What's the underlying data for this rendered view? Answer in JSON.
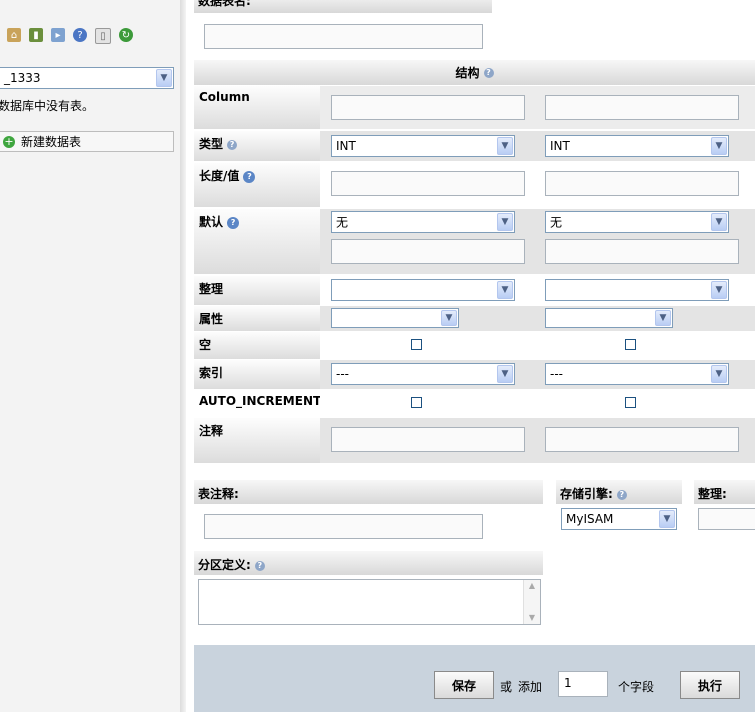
{
  "sidebar": {
    "toolbar_icons": [
      "home-icon",
      "exit-icon",
      "query-icon",
      "help-icon",
      "docs-icon",
      "reload-icon"
    ],
    "db_select_value": "_1333",
    "no_tables_text": "数据库中没有表。",
    "new_table_label": "新建数据表"
  },
  "form": {
    "table_name_label": "数据表名:",
    "structure_header": "结构",
    "rows": {
      "column": "Column",
      "type": "类型",
      "length": "长度/值",
      "default": "默认",
      "collation": "整理",
      "attributes": "属性",
      "null": "空",
      "index": "索引",
      "auto_increment": "AUTO_INCREMENT",
      "comment": "注释"
    },
    "fields": [
      {
        "type": "INT",
        "default": "无",
        "index": "---"
      },
      {
        "type": "INT",
        "default": "无",
        "index": "---"
      }
    ],
    "table_comment_label": "表注释:",
    "storage_engine_label": "存储引擎:",
    "storage_engine_value": "MyISAM",
    "collation_label": "整理:",
    "partition_label": "分区定义:",
    "footer": {
      "save_label": "保存",
      "or_text": "或",
      "add_text": "添加",
      "add_count": "1",
      "fields_text": "个字段",
      "go_label": "执行"
    }
  }
}
